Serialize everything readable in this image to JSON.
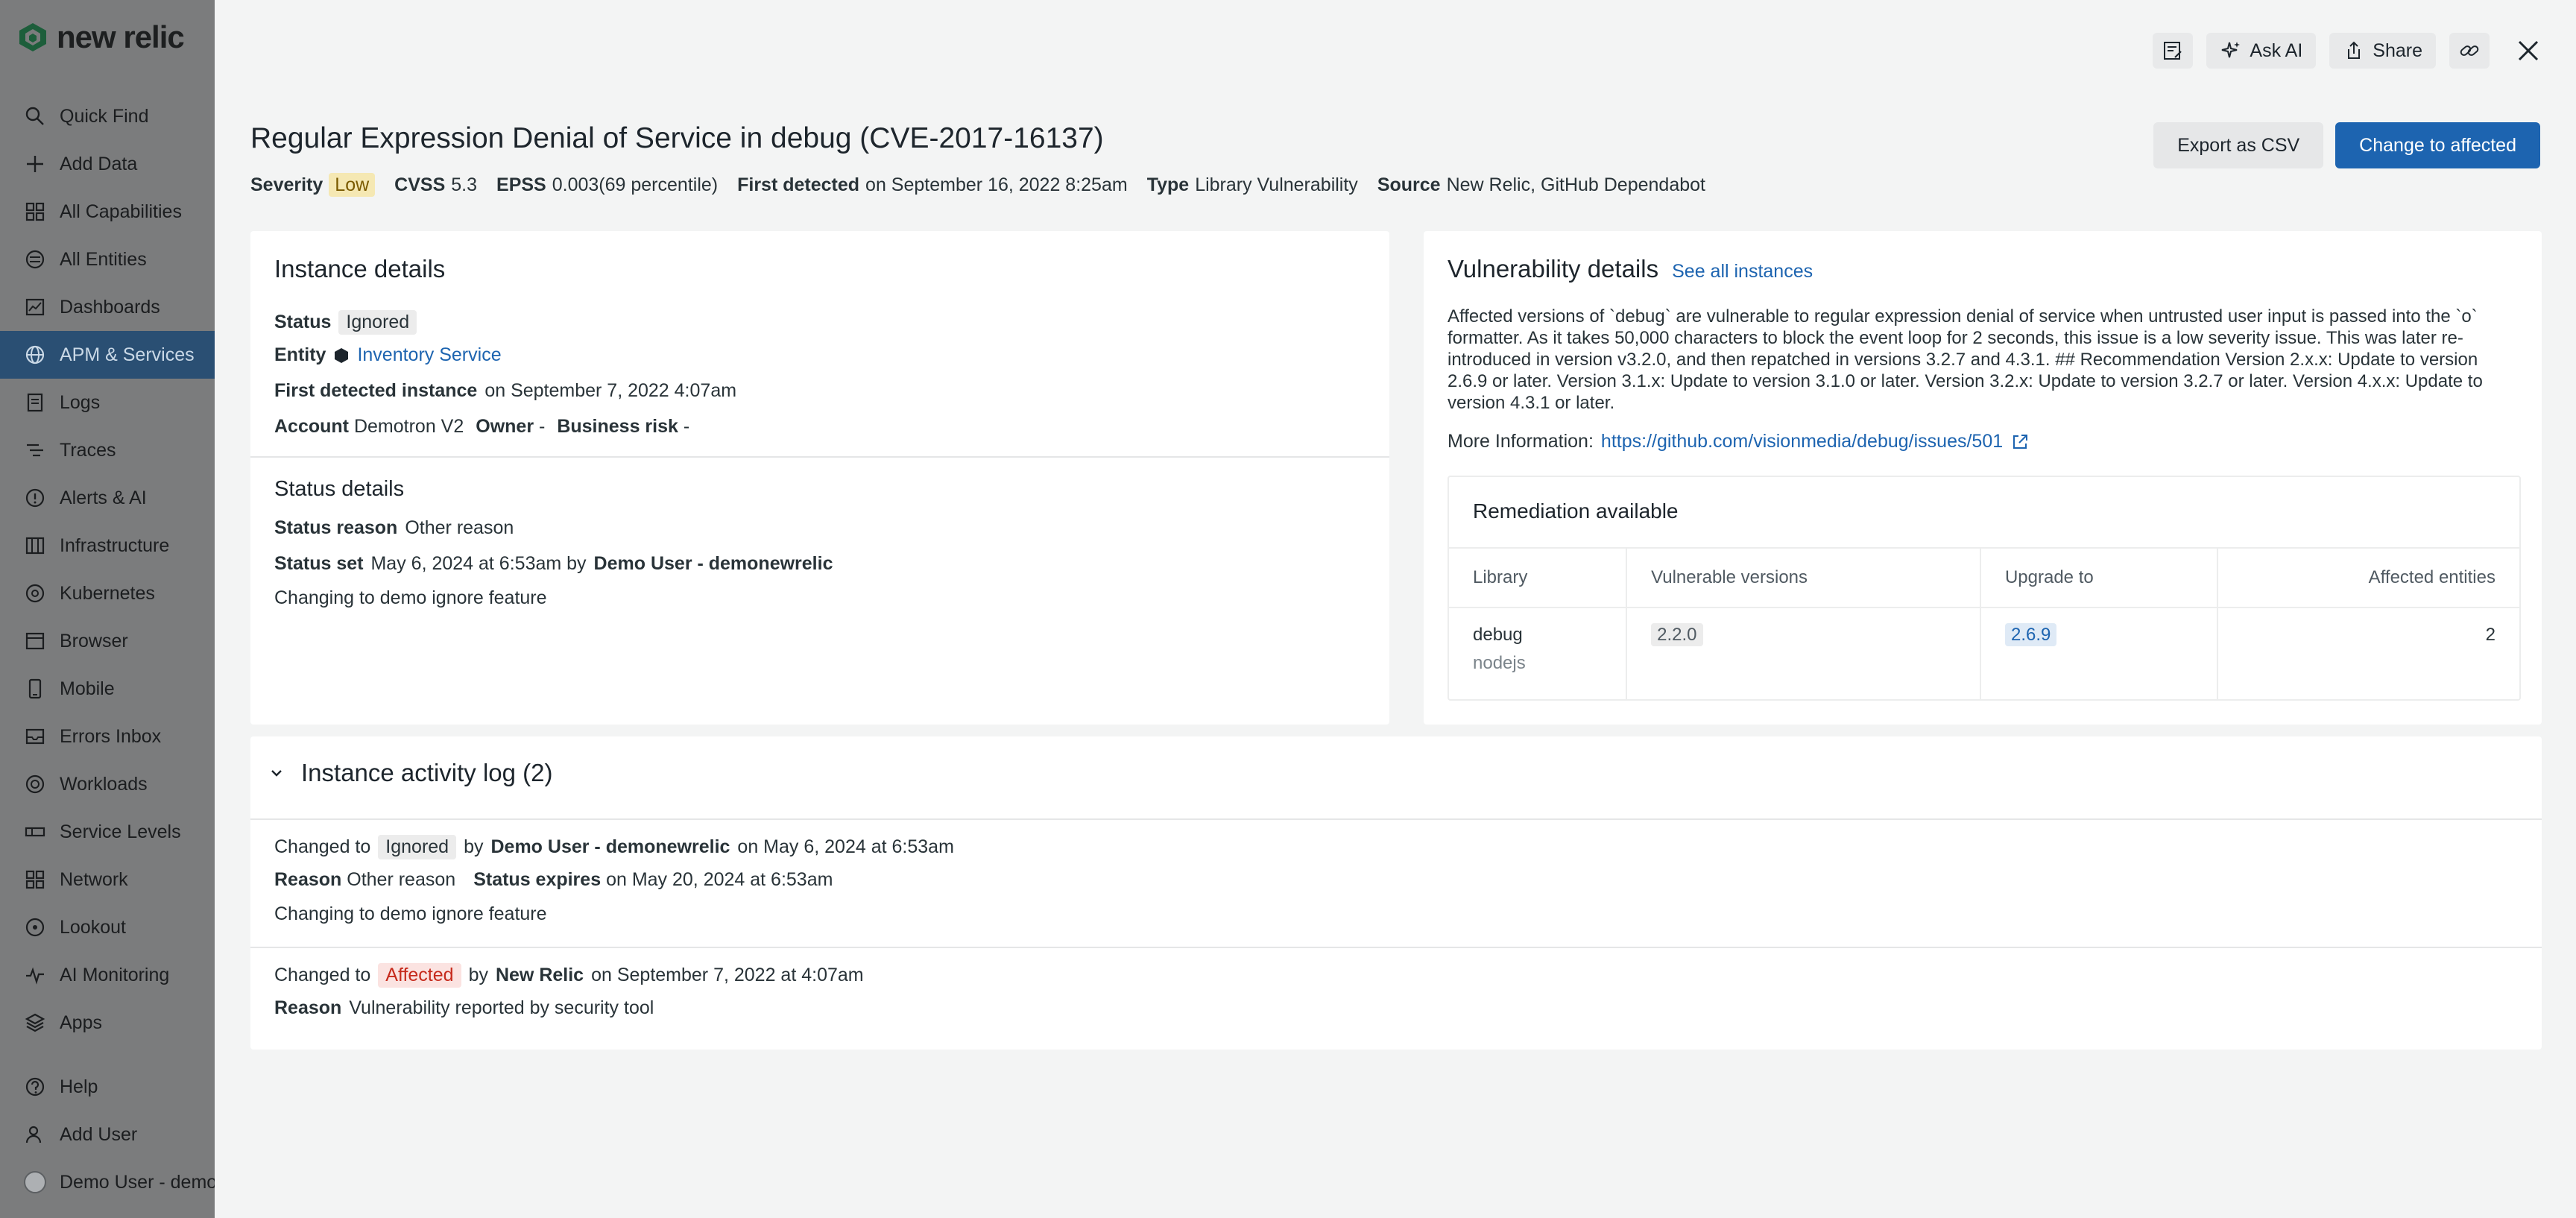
{
  "sidebar": {
    "brand": "new relic",
    "items": [
      {
        "label": "Quick Find",
        "icon": "search-icon"
      },
      {
        "label": "Add Data",
        "icon": "plus-icon"
      },
      {
        "label": "All Capabilities",
        "icon": "grid-icon"
      },
      {
        "label": "All Entities",
        "icon": "entities-icon"
      },
      {
        "label": "Dashboards",
        "icon": "dashboard-icon"
      },
      {
        "label": "APM & Services",
        "icon": "globe-icon",
        "active": true
      },
      {
        "label": "Logs",
        "icon": "logs-icon"
      },
      {
        "label": "Traces",
        "icon": "traces-icon"
      },
      {
        "label": "Alerts & AI",
        "icon": "alert-icon"
      },
      {
        "label": "Infrastructure",
        "icon": "infrastructure-icon"
      },
      {
        "label": "Kubernetes",
        "icon": "kubernetes-icon"
      },
      {
        "label": "Browser",
        "icon": "browser-icon"
      },
      {
        "label": "Mobile",
        "icon": "mobile-icon"
      },
      {
        "label": "Errors Inbox",
        "icon": "inbox-icon"
      },
      {
        "label": "Workloads",
        "icon": "workloads-icon"
      },
      {
        "label": "Service Levels",
        "icon": "service-levels-icon"
      },
      {
        "label": "Network",
        "icon": "network-icon"
      },
      {
        "label": "Lookout",
        "icon": "lookout-icon"
      },
      {
        "label": "AI Monitoring",
        "icon": "ai-monitoring-icon"
      },
      {
        "label": "Apps",
        "icon": "apps-icon"
      }
    ],
    "bottom": [
      {
        "label": "Help",
        "icon": "help-icon"
      },
      {
        "label": "Add User",
        "icon": "add-user-icon"
      },
      {
        "label": "Demo User - demo",
        "icon": "avatar"
      }
    ]
  },
  "toolbar": {
    "ask_ai": "Ask AI",
    "share": "Share"
  },
  "header": {
    "title": "Regular Expression Denial of Service in debug (CVE-2017-16137)",
    "severity_label": "Severity",
    "severity_value": "Low",
    "cvss_label": "CVSS",
    "cvss_value": "5.3",
    "epss_label": "EPSS",
    "epss_value": "0.003(69 percentile)",
    "first_detected_label": "First detected",
    "first_detected_value": "on September 16, 2022 8:25am",
    "type_label": "Type",
    "type_value": "Library Vulnerability",
    "source_label": "Source",
    "source_value": "New Relic, GitHub Dependabot",
    "export_button": "Export as CSV",
    "change_button": "Change to affected"
  },
  "instance": {
    "title": "Instance details",
    "status_label": "Status",
    "status_value": "Ignored",
    "entity_label": "Entity",
    "entity_value": "Inventory Service",
    "first_instance_label": "First detected instance",
    "first_instance_value": "on September 7, 2022 4:07am",
    "account_label": "Account",
    "account_value": "Demotron V2",
    "owner_label": "Owner",
    "owner_value": "-",
    "risk_label": "Business risk",
    "risk_value": "-",
    "status_details_title": "Status details",
    "reason_label": "Status reason",
    "reason_value": "Other reason",
    "set_label": "Status set",
    "set_value": "May 6, 2024 at 6:53am by",
    "set_by": "Demo User - demonewrelic",
    "note": "Changing to demo ignore feature"
  },
  "vulnerability": {
    "title": "Vulnerability details",
    "see_all": "See all instances",
    "description": "Affected versions of `debug` are vulnerable to regular expression denial of service when untrusted user input is passed into the `o` formatter. As it takes 50,000 characters to block the event loop for 2 seconds, this issue is a low severity issue. This was later re-introduced in version v3.2.0, and then repatched in versions 3.2.7 and 4.3.1. ## Recommendation Version 2.x.x: Update to version 2.6.9 or later. Version 3.1.x: Update to version 3.1.0 or later. Version 3.2.x: Update to version 3.2.7 or later. Version 4.x.x: Update to version 4.3.1 or later.",
    "more_label": "More Information:",
    "more_link": "https://github.com/visionmedia/debug/issues/501",
    "remediation": {
      "title": "Remediation available",
      "columns": [
        "Library",
        "Vulnerable versions",
        "Upgrade to",
        "Affected entities"
      ],
      "row": {
        "library": "debug",
        "package": "nodejs",
        "vulnerable": "2.2.0",
        "upgrade": "2.6.9",
        "affected": "2"
      }
    }
  },
  "activity": {
    "title": "Instance activity log (2)",
    "entries": [
      {
        "changed_to_label": "Changed to",
        "status": "Ignored",
        "by": "by",
        "user": "Demo User - demonewrelic",
        "when": "on May 6, 2024 at 6:53am",
        "reason_label": "Reason",
        "reason": "Other reason",
        "expires_label": "Status expires",
        "expires": "on May 20, 2024 at 6:53am",
        "note": "Changing to demo ignore feature"
      },
      {
        "changed_to_label": "Changed to",
        "status": "Affected",
        "by": "by",
        "user": "New Relic",
        "when": "on September 7, 2022 at 4:07am",
        "reason_label": "Reason",
        "reason": "Vulnerability reported by security tool"
      }
    ]
  },
  "colors": {
    "primary": "#1d64b0",
    "sidebar_overlay": "#7b7c7d",
    "active_nav": "#2a4f73",
    "low_badge": "#f5e8b3",
    "affected_red": "#c62a1c"
  }
}
